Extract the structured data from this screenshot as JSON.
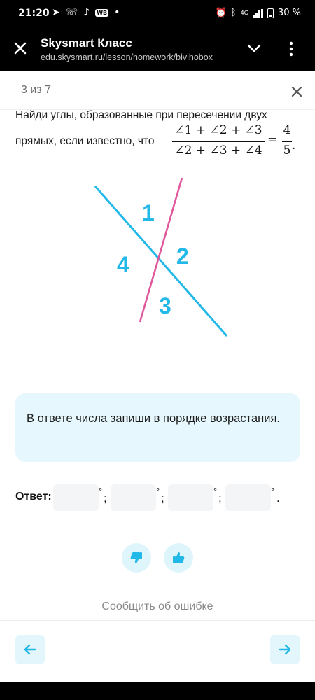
{
  "status_bar": {
    "time": "21:20",
    "network": "4G",
    "battery": "30 %"
  },
  "app_bar": {
    "title": "Skysmart Класс",
    "url": "edu.skysmart.ru/lesson/homework/bivihobox"
  },
  "progress": {
    "counter": "3 из 7"
  },
  "task": {
    "text_line1": "Найди углы, образованные при пересечении двух",
    "text_line2": "прямых, если известно, что",
    "formula": {
      "numerator": "∠1 + ∠2 + ∠3",
      "denominator": "∠2 + ∠3 + ∠4",
      "equals": "=",
      "rhs_numerator": "4",
      "rhs_denominator": "5",
      "period": "."
    },
    "figure": {
      "labels": [
        "1",
        "2",
        "3",
        "4"
      ],
      "colors": {
        "line_a": "#22b8e8",
        "line_b": "#e0579c",
        "label": "#22b8e8"
      }
    }
  },
  "hint": {
    "text": "В ответе числа запиши в порядке возрастания."
  },
  "answer": {
    "label": "Ответ:",
    "degree_symbol": "°",
    "separator": ";",
    "end": ".",
    "fields": [
      "",
      "",
      "",
      ""
    ]
  },
  "feedback": {
    "report_link": "Сообщить об ошибке"
  },
  "colors": {
    "accent": "#22b8e8",
    "hint_bg": "#e6f8fd"
  }
}
